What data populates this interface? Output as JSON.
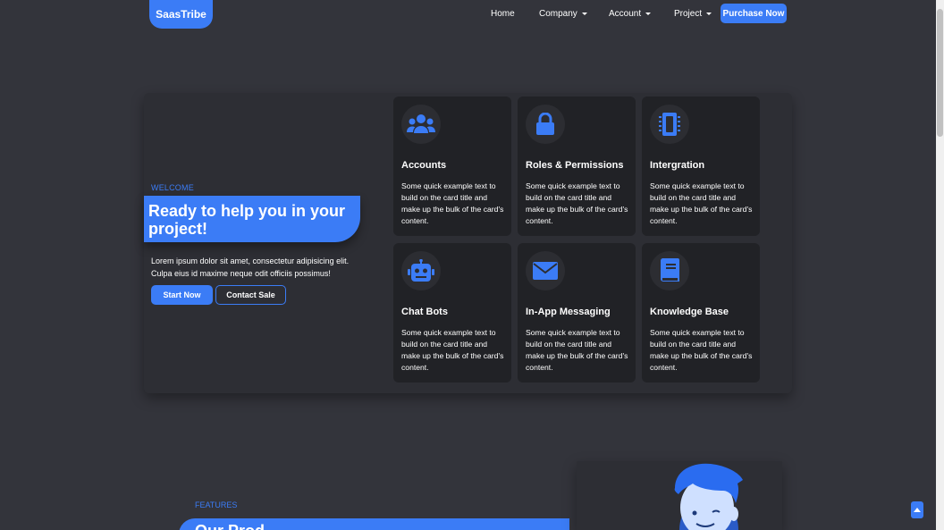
{
  "nav": {
    "logo": "SaasTribe",
    "items": [
      {
        "label": "Home"
      },
      {
        "label": "Company"
      },
      {
        "label": "Account"
      },
      {
        "label": "Project"
      }
    ],
    "purchase": "Purchase Now"
  },
  "hero": {
    "welcome": "WELCOME",
    "headline": "Ready to help you in your project!",
    "lorem": "Lorem ipsum dolor sit amet, consectetur adipisicing elit. Culpa eius id maxime neque odit officiis possimus!",
    "start": "Start Now",
    "contact": "Contact Sale"
  },
  "cards": [
    {
      "title": "Accounts",
      "icon": "users-icon",
      "body": "Some quick example text to build on the card title and make up the bulk of the card's content."
    },
    {
      "title": "Roles & Permissions",
      "icon": "lock-icon",
      "body": "Some quick example text to build on the card title and make up the bulk of the card's content."
    },
    {
      "title": "Intergration",
      "icon": "chip-icon",
      "body": "Some quick example text to build on the card title and make up the bulk of the card's content."
    },
    {
      "title": "Chat Bots",
      "icon": "robot-icon",
      "body": "Some quick example text to build on the card title and make up the bulk of the card's content."
    },
    {
      "title": "In-App Messaging",
      "icon": "envelope-icon",
      "body": "Some quick example text to build on the card title and make up the bulk of the card's content."
    },
    {
      "title": "Knowledge Base",
      "icon": "book-icon",
      "body": "Some quick example text to build on the card title and make up the bulk of the card's content."
    }
  ],
  "features": {
    "label": "FEATURES",
    "title": "Our Prod..."
  },
  "colors": {
    "accent": "#3b7cf6",
    "background": "#33343b",
    "panel": "#2d2e34",
    "card": "#212226"
  }
}
